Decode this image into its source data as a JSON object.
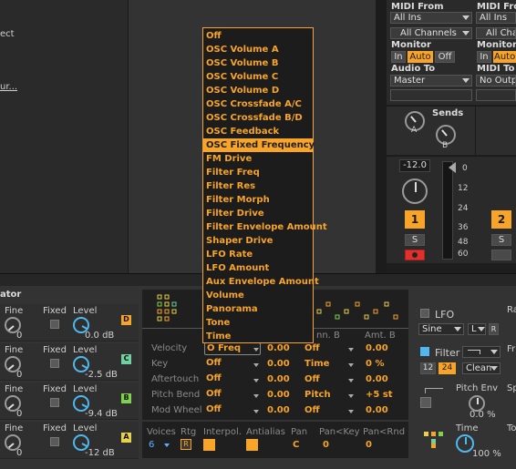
{
  "left_panel": {
    "label_1": "ect",
    "label_2": "ur..."
  },
  "io": {
    "col1": {
      "midi_from": "MIDI From",
      "midi_from_value": "All Ins",
      "channel_value": "All Channels",
      "monitor": "Monitor",
      "mon_in": "In",
      "mon_auto": "Auto",
      "mon_off": "Off",
      "audio_to": "Audio To",
      "audio_to_value": "Master"
    },
    "col2": {
      "midi_from": "MIDI From",
      "midi_from_value": "All Ins",
      "channel_value": "All Chann",
      "monitor": "Monitor",
      "mon_in": "In",
      "mon_auto": "Auto",
      "midi_to": "MIDI To",
      "midi_to_value": "No Outp"
    }
  },
  "sends": {
    "title": "Sends",
    "a": "A",
    "b": "B"
  },
  "mixer": {
    "volume": "-12.0",
    "scale": [
      "0",
      "12",
      "24",
      "36",
      "48",
      "60"
    ],
    "track_number": "1",
    "track2_number": "2",
    "solo": "S"
  },
  "dropdown": {
    "selected_index": 8,
    "items": [
      "Off",
      "OSC Volume A",
      "OSC Volume B",
      "OSC Volume C",
      "OSC Volume D",
      "OSC Crossfade A/C",
      "OSC Crossfade B/D",
      "OSC Feedback",
      "OSC Fixed Frequency",
      "FM Drive",
      "Filter Freq",
      "Filter Res",
      "Filter Morph",
      "Filter Drive",
      "Filter Envelope Amount",
      "Shaper Drive",
      "LFO Rate",
      "LFO Amount",
      "Aux Envelope Amount",
      "Volume",
      "Panorama",
      "Tone",
      "Time"
    ]
  },
  "operators": {
    "title": "ator",
    "rows": [
      {
        "fine": "Fine",
        "fine_val": "0",
        "fixed": "Fixed",
        "level": "Level",
        "level_val": "0.0 dB",
        "tag": "D",
        "color": "#f7a428"
      },
      {
        "fine": "Fine",
        "fine_val": "0",
        "fixed": "Fixed",
        "level": "Level",
        "level_val": "-2.5 dB",
        "tag": "C",
        "color": "#6fd0a0"
      },
      {
        "fine": "Fine",
        "fine_val": "0",
        "fixed": "Fixed",
        "level": "Level",
        "level_val": "-9.4 dB",
        "tag": "B",
        "color": "#7fd24a"
      },
      {
        "fine": "Fine",
        "fine_val": "0",
        "fixed": "Fixed",
        "level": "Level",
        "level_val": "-12 dB",
        "tag": "A",
        "color": "#e8d048"
      }
    ]
  },
  "matrix": {
    "col_b": "nn. B",
    "col_amt": "Amt. B",
    "rows": [
      {
        "label": "Velocity",
        "dest_a": "O Freq",
        "amt_a": "0.00",
        "dest_b": "Off",
        "amt_b": "0.00"
      },
      {
        "label": "Key",
        "dest_a": "Off",
        "amt_a": "0.00",
        "dest_b": "Time",
        "amt_b": "0 %"
      },
      {
        "label": "Aftertouch",
        "dest_a": "Off",
        "amt_a": "0.00",
        "dest_b": "Off",
        "amt_b": "0.00"
      },
      {
        "label": "Pitch Bend",
        "dest_a": "Off",
        "amt_a": "0.00",
        "dest_b": "Pitch",
        "amt_b": "+5 st"
      },
      {
        "label": "Mod Wheel",
        "dest_a": "Off",
        "amt_a": "0.00",
        "dest_b": "Off",
        "amt_b": "0.00"
      }
    ],
    "footer": {
      "voices": "Voices",
      "voices_val": "6",
      "rtg": "Rtg",
      "rtg_val": "R",
      "interpol": "Interpol.",
      "antialias": "Antialias",
      "pan": "Pan",
      "pan_val": "C",
      "pan_key": "Pan<Key",
      "pan_key_val": "0",
      "pan_rnd": "Pan<Rnd",
      "pan_rnd_val": "0"
    }
  },
  "right": {
    "lfo": "LFO",
    "lfo_wave": "Sine",
    "lfo_l": "L",
    "lfo_r": "R",
    "ra": "Ra",
    "filter": "Filter",
    "filter_12": "12",
    "filter_24": "24",
    "filter_clean": "Clean",
    "fr": "Fr",
    "pitch_env": "Pitch Env",
    "pitch_env_val": "0.0 %",
    "sp": "Sp",
    "time": "Time",
    "time_val": "100 %",
    "to": "To"
  }
}
